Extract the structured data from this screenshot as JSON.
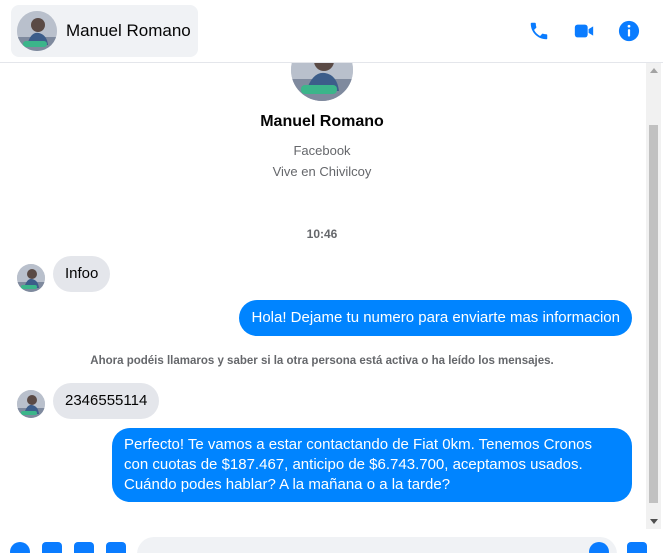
{
  "header": {
    "contact_name": "Manuel Romano",
    "icons": [
      "phone-icon",
      "video-camera-icon",
      "info-icon"
    ]
  },
  "profile": {
    "name": "Manuel Romano",
    "line1": "Facebook",
    "line2": "Vive en Chivilcoy"
  },
  "conversation": {
    "timestamp": "10:46",
    "notice": "Ahora podéis llamaros y saber si la otra persona está activa o ha leído los mensajes.",
    "messages": [
      {
        "direction": "in",
        "text": "Infoo"
      },
      {
        "direction": "out",
        "text": "Hola! Dejame tu numero para enviarte mas informacion"
      },
      {
        "direction": "in",
        "text": "2346555114"
      },
      {
        "direction": "out",
        "text": "Perfecto! Te vamos a estar contactando de Fiat 0km. Tenemos Cronos con cuotas de $187.467, anticipo de $6.743.700, aceptamos usados. Cuándo podes hablar? A la mañana o a la tarde?"
      }
    ]
  },
  "composer": {
    "value": "",
    "icons": [
      "plus-icon",
      "image-icon",
      "sticker-icon",
      "gif-icon",
      "emoji-icon",
      "like-icon"
    ]
  },
  "colors": {
    "accent": "#0a7cff",
    "outgoing_bubble": "#0084ff",
    "incoming_bubble": "#e4e6eb",
    "muted_text": "#65676b"
  }
}
